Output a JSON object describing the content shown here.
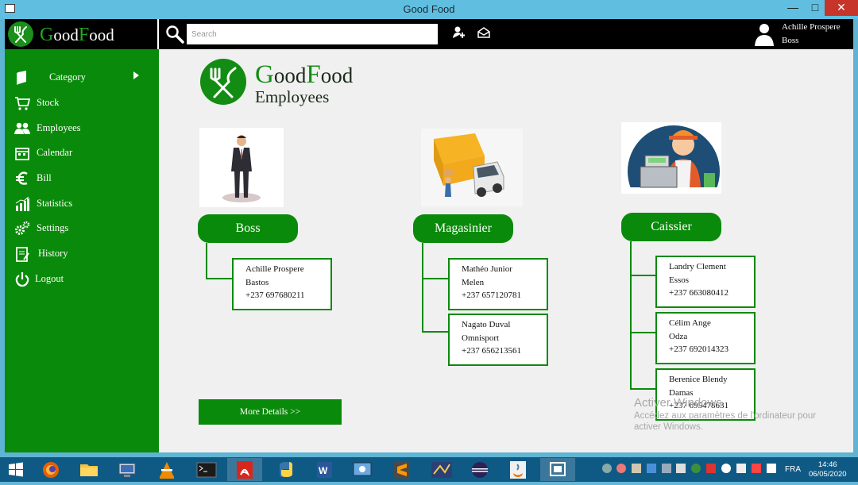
{
  "window": {
    "title": "Good Food"
  },
  "brand": {
    "first_letter": "G",
    "name_part1": "ood",
    "second_letter": "F",
    "name_part2": "ood"
  },
  "search": {
    "placeholder": "Search"
  },
  "user": {
    "name": "Achille Prospere",
    "role": "Boss"
  },
  "sidebar": {
    "items": [
      {
        "label": "Category",
        "icon": "book-icon",
        "has_submenu": true
      },
      {
        "label": "Stock",
        "icon": "cart-icon"
      },
      {
        "label": "Employees",
        "icon": "users-icon"
      },
      {
        "label": "Calendar",
        "icon": "calendar-icon"
      },
      {
        "label": "Bill",
        "icon": "euro-icon"
      },
      {
        "label": "Statistics",
        "icon": "chart-icon"
      },
      {
        "label": "Settings",
        "icon": "gears-icon"
      },
      {
        "label": "History",
        "icon": "history-icon"
      },
      {
        "label": "Logout",
        "icon": "power-icon"
      }
    ]
  },
  "page": {
    "title_G": "G",
    "title_ood": "ood",
    "title_F": "F",
    "title_ood2": "ood",
    "subtitle": "Employees"
  },
  "roles": [
    {
      "label": "Boss",
      "image": "businessman-illustration",
      "employees": [
        {
          "name1": "Achille Prospere",
          "name2": "Bastos",
          "phone": "+237 697680211"
        }
      ]
    },
    {
      "label": "Magasinier",
      "image": "delivery-truck-illustration",
      "employees": [
        {
          "name1": "Mathéo Junior",
          "name2": "Melen",
          "phone": "+237 657120781"
        },
        {
          "name1": "Nagato Duval",
          "name2": "Omnisport",
          "phone": "+237 656213561"
        }
      ]
    },
    {
      "label": "Caissier",
      "image": "cashier-illustration",
      "employees": [
        {
          "name1": "Landry Clement",
          "name2": "Essos",
          "phone": "+237 663080412"
        },
        {
          "name1": "Célim Ange",
          "name2": "Odza",
          "phone": "+237 692014323"
        },
        {
          "name1": "Berenice Blendy",
          "name2": "Damas",
          "phone": "+237 695478631"
        }
      ]
    }
  ],
  "more_details": "More Details >>",
  "watermark": {
    "line1": "Activer Windows",
    "line2": "Accédez aux paramètres de l'ordinateur pour",
    "line3": "activer Windows."
  },
  "taskbar": {
    "lang": "FRA",
    "time": "14:46",
    "date": "06/05/2020"
  },
  "colors": {
    "accent_green": "#0a8a0a",
    "taskbar": "#0f5a85",
    "titlebar": "#60bfe0"
  }
}
